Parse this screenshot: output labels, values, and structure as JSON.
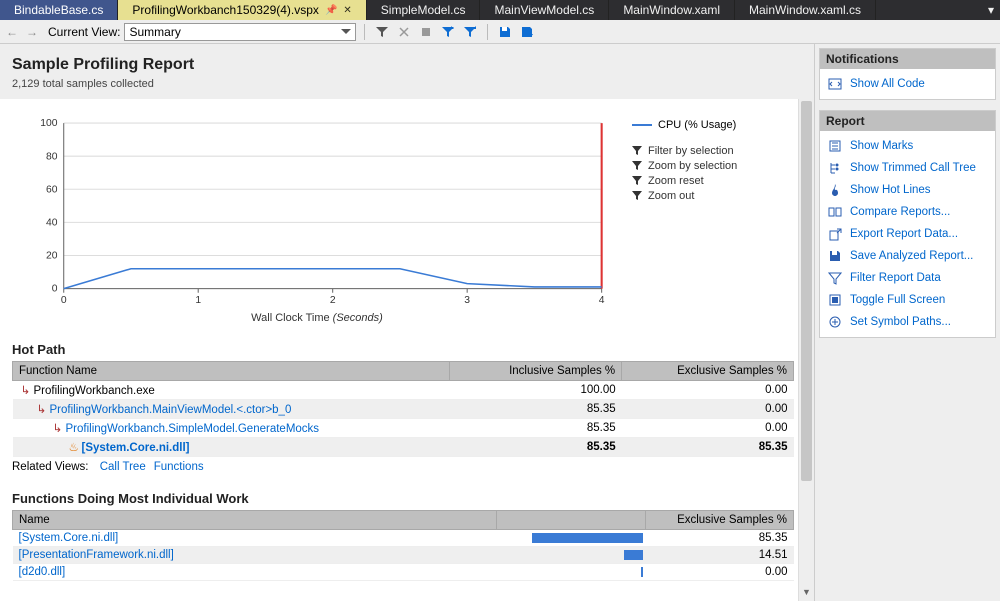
{
  "tabs": {
    "items": [
      {
        "label": "BindableBase.cs",
        "state": "highlight"
      },
      {
        "label": "ProfilingWorkbanch150329(4).vspx",
        "state": "active",
        "pinned": true,
        "closable": true
      },
      {
        "label": "SimpleModel.cs",
        "state": "normal"
      },
      {
        "label": "MainViewModel.cs",
        "state": "normal"
      },
      {
        "label": "MainWindow.xaml",
        "state": "normal"
      },
      {
        "label": "MainWindow.xaml.cs",
        "state": "normal"
      }
    ]
  },
  "toolbar": {
    "current_view_label": "Current View:",
    "view_value": "Summary"
  },
  "header": {
    "title": "Sample Profiling Report",
    "subtitle": "2,129 total samples collected"
  },
  "chart_data": {
    "type": "line",
    "series_name": "CPU (% Usage)",
    "xlabel_prefix": "Wall Clock Time",
    "xlabel_suffix": "(Seconds)",
    "ylabel": "",
    "x_ticks": [
      0,
      1,
      2,
      3,
      4
    ],
    "y_ticks": [
      0,
      20,
      40,
      60,
      80,
      100
    ],
    "xlim": [
      0,
      4
    ],
    "ylim": [
      0,
      100
    ],
    "x": [
      0,
      0.5,
      1.0,
      2.0,
      2.5,
      3.0,
      3.5,
      4.0
    ],
    "y": [
      0,
      12,
      12,
      12,
      12,
      3,
      1,
      1
    ],
    "marker_x": 4.0
  },
  "chart_legend": {
    "actions": [
      {
        "label": "Filter by selection"
      },
      {
        "label": "Zoom by selection"
      },
      {
        "label": "Zoom reset"
      },
      {
        "label": "Zoom out"
      }
    ]
  },
  "hotpath": {
    "title": "Hot Path",
    "col_fn": "Function Name",
    "col_inc": "Inclusive Samples %",
    "col_exc": "Exclusive Samples %",
    "rows": [
      {
        "depth": 0,
        "icon": "arrow",
        "name": "ProfilingWorkbanch.exe",
        "link": false,
        "inc": "100.00",
        "exc": "0.00"
      },
      {
        "depth": 1,
        "icon": "arrow",
        "name": "ProfilingWorkbanch.MainViewModel.<.ctor>b_0",
        "link": true,
        "inc": "85.35",
        "exc": "0.00"
      },
      {
        "depth": 2,
        "icon": "arrow",
        "name": "ProfilingWorkbanch.SimpleModel.GenerateMocks",
        "link": true,
        "inc": "85.35",
        "exc": "0.00"
      },
      {
        "depth": 3,
        "icon": "flame",
        "name": "[System.Core.ni.dll]",
        "link": true,
        "bold": true,
        "inc": "85.35",
        "exc": "85.35"
      }
    ],
    "related_label": "Related Views:",
    "related_links": [
      "Call Tree",
      "Functions"
    ]
  },
  "topfn": {
    "title": "Functions Doing Most Individual Work",
    "col_name": "Name",
    "col_exc": "Exclusive Samples %",
    "rows": [
      {
        "name": "[System.Core.ni.dll]",
        "exc": "85.35",
        "bar": 85.35
      },
      {
        "name": "[PresentationFramework.ni.dll]",
        "exc": "14.51",
        "bar": 14.51
      },
      {
        "name": "[d2d0.dll]",
        "exc": "0.00",
        "bar": 0
      }
    ]
  },
  "side": {
    "notifications": {
      "title": "Notifications",
      "items": [
        {
          "label": "Show All Code",
          "icon": "code"
        }
      ]
    },
    "report": {
      "title": "Report",
      "items": [
        {
          "label": "Show Marks",
          "icon": "marks"
        },
        {
          "label": "Show Trimmed Call Tree",
          "icon": "tree"
        },
        {
          "label": "Show Hot Lines",
          "icon": "hot"
        },
        {
          "label": "Compare Reports...",
          "icon": "compare"
        },
        {
          "label": "Export Report Data...",
          "icon": "export"
        },
        {
          "label": "Save Analyzed Report...",
          "icon": "save"
        },
        {
          "label": "Filter Report Data",
          "icon": "filter"
        },
        {
          "label": "Toggle Full Screen",
          "icon": "fullscreen"
        },
        {
          "label": "Set Symbol Paths...",
          "icon": "symbols"
        }
      ]
    }
  }
}
